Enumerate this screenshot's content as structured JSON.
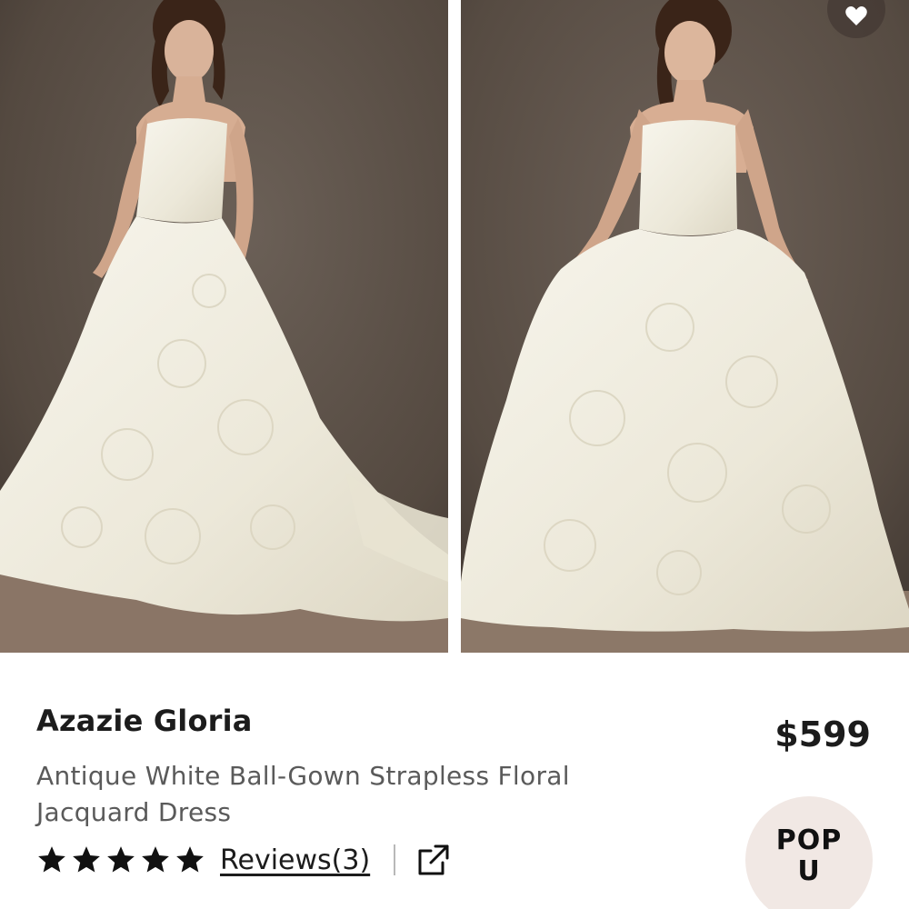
{
  "product": {
    "brand": "Azazie Gloria",
    "price": "$599",
    "description": "Antique White Ball-Gown Strapless Floral Jacquard Dress",
    "rating_stars": 5,
    "reviews_label": "Reviews(3)"
  },
  "gallery": {
    "images": [
      {
        "name": "dress-photo-front-angle"
      },
      {
        "name": "dress-photo-front-holding-skirt"
      }
    ]
  },
  "popup": {
    "line1": "POP",
    "line2": "U"
  },
  "icons": {
    "star": "star-icon",
    "share": "external-link-icon",
    "wishlist": "heart-icon"
  },
  "colors": {
    "text_primary": "#1c1c1c",
    "text_secondary": "#5a5a5a",
    "photo_backdrop": "#5e5248",
    "dress": "#f3f0e4",
    "popup_bg": "#f1e8e4"
  }
}
